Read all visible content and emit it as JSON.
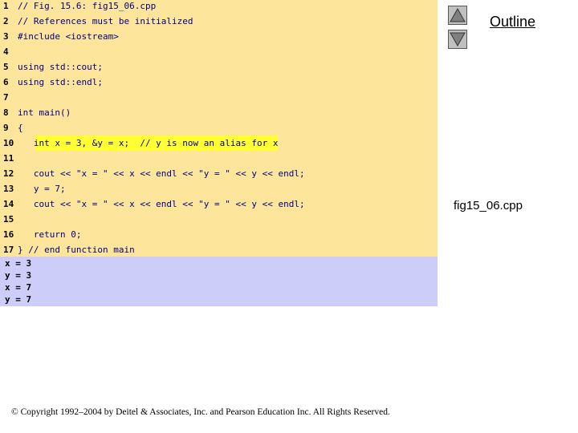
{
  "code": {
    "lines": [
      {
        "num": "1",
        "text": "// Fig. 15.6: fig15_06.cpp"
      },
      {
        "num": "2",
        "text": "// References must be initialized"
      },
      {
        "num": "3",
        "text": "#include <iostream>"
      },
      {
        "num": "4",
        "text": ""
      },
      {
        "num": "5",
        "text": "using std::cout;"
      },
      {
        "num": "6",
        "text": "using std::endl;"
      },
      {
        "num": "7",
        "text": ""
      },
      {
        "num": "8",
        "text": "int main()"
      },
      {
        "num": "9",
        "text": "{"
      },
      {
        "num": "10",
        "text": "   int x = 3, &y = x;  // y is now an alias for x"
      },
      {
        "num": "11",
        "text": ""
      },
      {
        "num": "12",
        "text": "   cout << \"x = \" << x << endl << \"y = \" << y << endl;"
      },
      {
        "num": "13",
        "text": "   y = 7;"
      },
      {
        "num": "14",
        "text": "   cout << \"x = \" << x << endl << \"y = \" << y << endl;"
      },
      {
        "num": "15",
        "text": ""
      },
      {
        "num": "16",
        "text": "   return 0;"
      },
      {
        "num": "17",
        "text": "} // end function main"
      }
    ],
    "highlighted_line": "10"
  },
  "output": {
    "lines": [
      "x = 3",
      "y = 3",
      "x = 7",
      "y = 7"
    ]
  },
  "nav": {
    "outline_label": "Outline",
    "file_name": "fig15_06.cpp",
    "prev_icon": "triangle-up-icon",
    "next_icon": "triangle-down-icon"
  },
  "footer": {
    "copyright": "© Copyright 1992–2004 by Deitel & Associates, Inc. and Pearson Education Inc. All Rights Reserved."
  },
  "colors": {
    "code_background": "#fde59b",
    "highlight": "#ffff33",
    "output_background": "#cdcdf9",
    "code_text": "#000080"
  }
}
